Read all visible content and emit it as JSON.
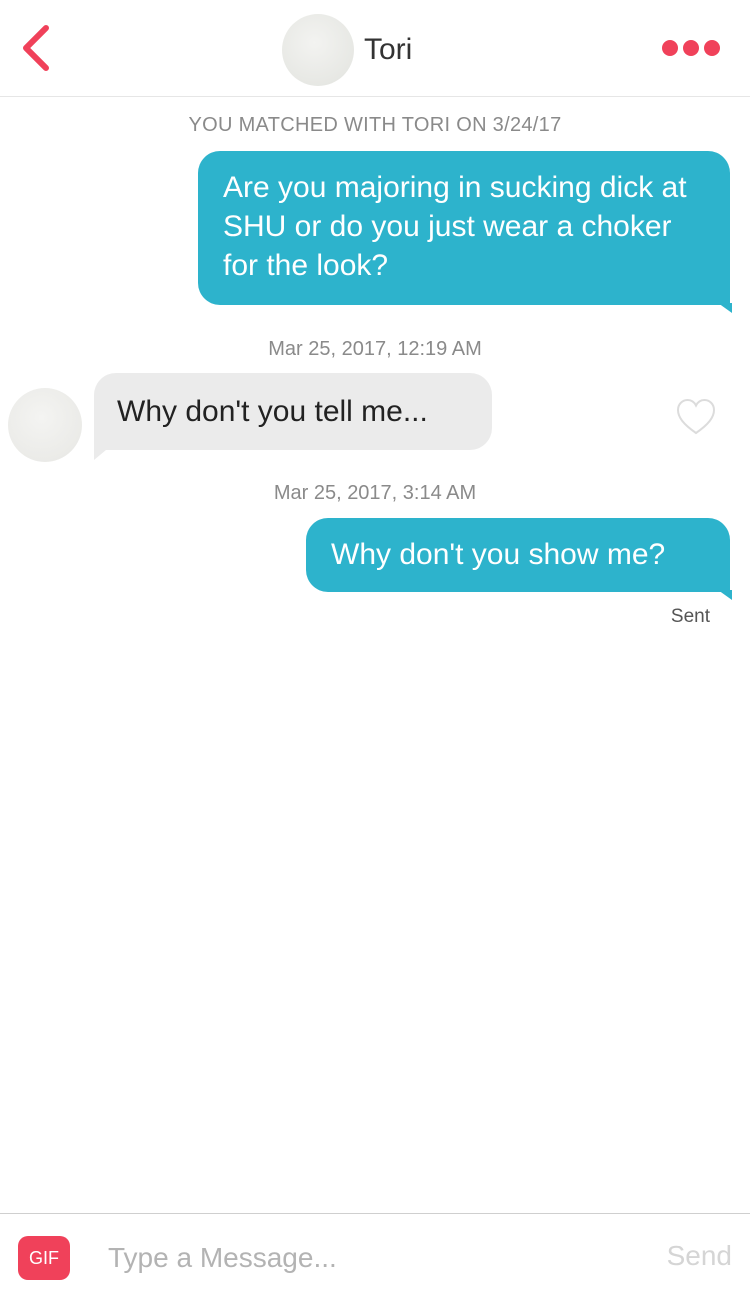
{
  "header": {
    "name": "Tori",
    "accent_color": "#f0415a",
    "back_icon": "chevron-left-icon",
    "more_icon": "more-dots-icon"
  },
  "chat": {
    "match_note": "YOU MATCHED WITH TORI ON 3/24/17",
    "messages": [
      {
        "direction": "outgoing",
        "text": "Are you majoring in sucking dick at SHU or do you just wear a choker for the look?"
      },
      {
        "timestamp": "Mar 25, 2017, 12:19 AM",
        "direction": "incoming",
        "text": "Why don't you tell me..."
      },
      {
        "timestamp": "Mar 25, 2017, 3:14 AM",
        "direction": "outgoing",
        "text": "Why don't you show me?",
        "status": "Sent"
      }
    ],
    "outgoing_color": "#2db3cc",
    "incoming_color": "#ebebeb"
  },
  "composer": {
    "gif_label": "GIF",
    "placeholder": "Type a Message...",
    "value": "",
    "send_label": "Send"
  }
}
